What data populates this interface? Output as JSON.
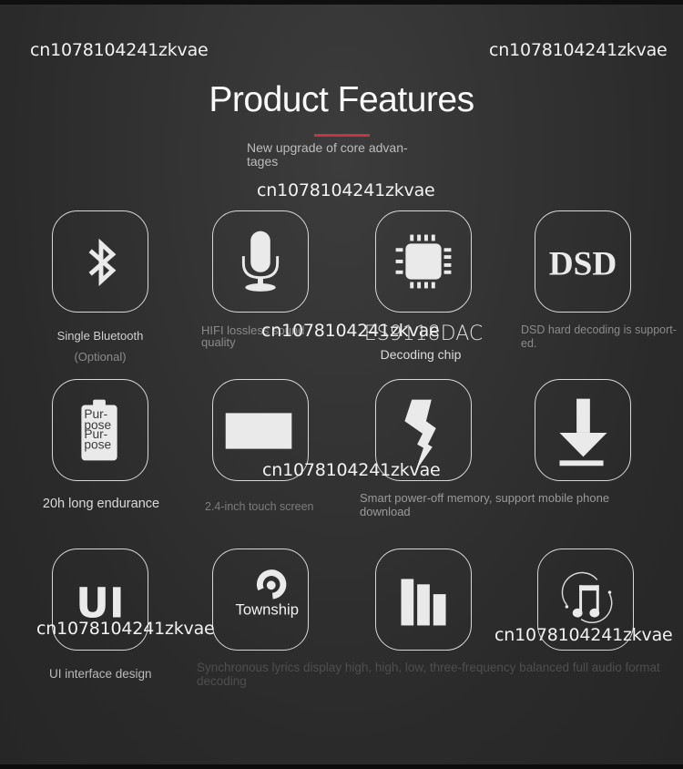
{
  "watermark": "cn1078104241zkvae",
  "header": {
    "title": "Product Features",
    "subtitle": "New upgrade of core advan-\ntages",
    "accent_color": "#c4353f"
  },
  "features": [
    {
      "icon": "bluetooth-icon",
      "label": "Single Bluetooth",
      "note": "(Optional)"
    },
    {
      "icon": "microphone-icon",
      "label": "HIFI lossless sound quality"
    },
    {
      "icon": "chip-icon",
      "label": "ES9118DAC",
      "note": "Decoding chip"
    },
    {
      "icon": "dsd-icon",
      "icon_text": "DSD",
      "label": "DSD hard decoding is support-ed."
    },
    {
      "icon": "battery-icon",
      "icon_text": "Pur-pose",
      "label": "20h long endurance"
    },
    {
      "icon": "screen-icon",
      "label": "2.4-inch touch screen"
    },
    {
      "icon": "lightning-icon",
      "label": "Smart power-off memory, support mobile phone download"
    },
    {
      "icon": "download-icon",
      "label": ""
    },
    {
      "icon": "ui-icon",
      "icon_text": "UI",
      "label": "UI interface design"
    },
    {
      "icon": "township-icon",
      "icon_text": "Township",
      "label": "Synchronous lyrics display high, high, low, three-frequency balanced full audio format decoding"
    },
    {
      "icon": "equalizer-icon",
      "label": ""
    },
    {
      "icon": "music-note-icon",
      "label": ""
    }
  ]
}
